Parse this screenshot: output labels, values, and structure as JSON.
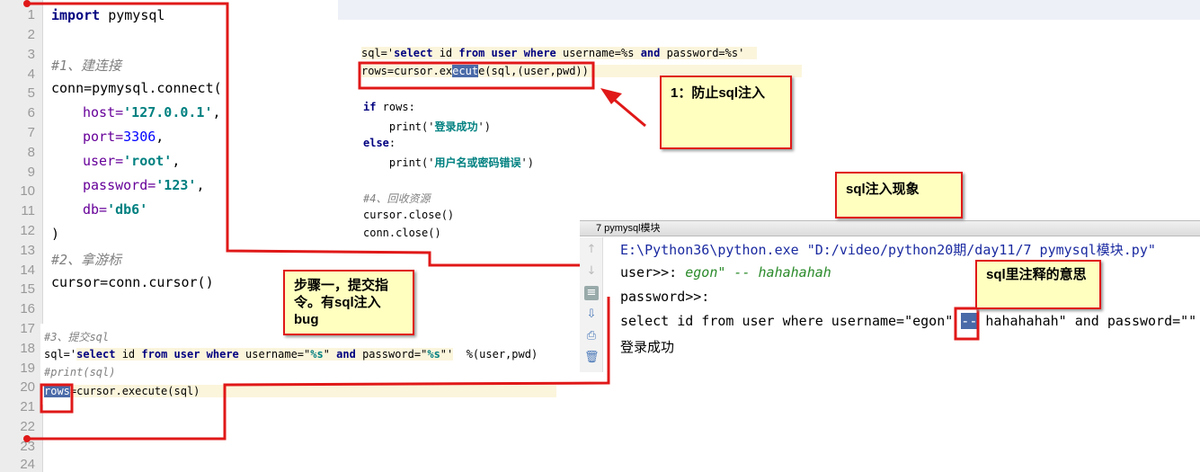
{
  "gutter": {
    "lines": [
      "1",
      "2",
      "3",
      "4",
      "5",
      "6",
      "7",
      "8",
      "9",
      "10",
      "11",
      "12",
      "13",
      "14",
      "15",
      "16",
      "17",
      "18",
      "19",
      "20",
      "21",
      "22",
      "23",
      "24"
    ]
  },
  "main_code": {
    "l1_kw": "import",
    "l1_rest": " pymysql",
    "l4": "#1、建连接",
    "l5": "conn=pymysql.connect(",
    "host_k": "host=",
    "host_v": "'127.0.0.1'",
    "comma": ",",
    "port_k": "port=",
    "port_v": "3306",
    "user_k": "user=",
    "user_v": "'root'",
    "pwd_k": "password=",
    "pwd_v": "'123'",
    "db_k": "db=",
    "db_v": "'db6'",
    "close": ")",
    "l13": "#2、拿游标",
    "l15": "cursor=conn.cursor()"
  },
  "snippet2": {
    "sql_pre": "sql='",
    "sql_sel": "select",
    "sql_id": " id ",
    "sql_from": "from",
    "sql_user": " user ",
    "sql_where": "where",
    "sql_mid": " username=%s ",
    "sql_and": "and",
    "sql_end": " password=%s'",
    "exec_pre": "rows=cursor.ex",
    "exec_sel": "ecut",
    "exec_post": "e(sql,(user,pwd))",
    "if_kw": "if",
    "if_rest": " rows:",
    "print1_pre": "    print('",
    "print1_str": "登录成功",
    "print1_post": "')",
    "else_kw": "else",
    ":": ":",
    "print2_pre": "    print('",
    "print2_str": "用户名或密码错误",
    "print2_post": "')",
    "comment": "#4、回收资源",
    "close1": "cursor.close()",
    "close2": "conn.close()"
  },
  "console": {
    "title": "7 pymysql模块",
    "line1": "E:\\Python36\\python.exe \"D:/video/python20期/day11/7 pymysql模块.py\"",
    "line2_prompt": "user>>: ",
    "line2_input": "egon\" -- hahahahah",
    "line3": "password>>:",
    "line4_pre": "select id from user where username=\"egon\" ",
    "line4_sel": "--",
    "line4_post": " hahahahah\" and password=\"\"",
    "line5": "登录成功",
    "tools": [
      "up-arrow",
      "down-arrow",
      "soft-wrap",
      "scroll-to-end",
      "print",
      "trash"
    ]
  },
  "snippet3": {
    "comment": "#3、提交sql",
    "sql_pre": "sql='",
    "sql_sel": "select",
    "sql_id": " id ",
    "sql_from": "from",
    "sql_user": " user ",
    "sql_where": "where",
    "sql_mid": " username=\"",
    "p1": "%s",
    "q1": "\" ",
    "sql_and": "and",
    "sql_pw": " password=\"",
    "p2": "%s",
    "q2": "\"'",
    "fmt": "  %(user,pwd)",
    "print_comment": "#print(sql)",
    "rows": "rows",
    "exec": "=cursor.execute(sql)"
  },
  "notes": {
    "prevent": "1：防止sql注入",
    "phenomenon": "sql注入现象",
    "step1": "步骤一，提交指令。有sql注入bug",
    "comment_meaning": "sql里注释的意思"
  },
  "colors": {
    "annotation": "#e01818",
    "note_bg": "#ffffc0",
    "selection": "#4a6aa8"
  }
}
